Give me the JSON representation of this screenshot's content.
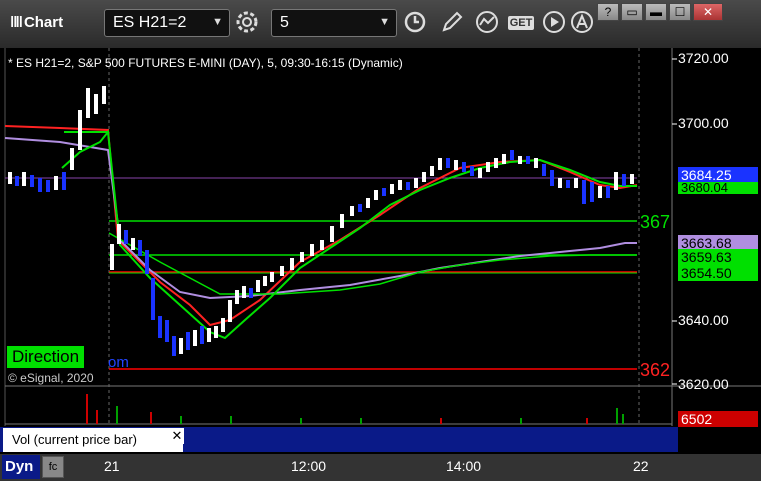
{
  "window": {
    "title": "Chart",
    "symbol": "ES H21=2",
    "interval": "5",
    "buttons": {
      "help": "?",
      "restore": "▭",
      "maximize": "☐",
      "close": "✕"
    }
  },
  "chart": {
    "header": "* ES H21=2, S&P 500 FUTURES E-MINI (DAY), 5, 09:30-16:15 (Dynamic)",
    "direction_label": "Direction",
    "copyright": "© eSignal, 2020",
    "fragment": "om",
    "y_ticks": [
      "3720.00",
      "3700.00",
      "3640.00",
      "3620.00"
    ],
    "x_ticks": [
      "21",
      "12:00",
      "14:00",
      "22"
    ],
    "price_labels": [
      {
        "text": "3684.25",
        "bg": "#1a33ff",
        "fg": "#ffffff"
      },
      {
        "text": "3680.04",
        "bg": "#00e000",
        "fg": "#000000"
      },
      {
        "text": "3663.68",
        "bg": "#b08ee0",
        "fg": "#000000"
      },
      {
        "text": "3659.63",
        "bg": "#00e000",
        "fg": "#000000"
      },
      {
        "text": "3654.50",
        "bg": "#00e000",
        "fg": "#000000"
      },
      {
        "text": "6502",
        "bg": "#cc0000",
        "fg": "#ffffff"
      }
    ],
    "line_labels": {
      "green_level": "367",
      "red_level": "362"
    }
  },
  "volume": {
    "label": "Vol (current price bar)",
    "close": "✕"
  },
  "bottom": {
    "mode": "Dyn",
    "fc": "fc"
  },
  "colors": {
    "up": "#ffffff",
    "down": "#1a33ff",
    "green": "#00e000",
    "red": "#ff0000",
    "purple": "#b08ee0"
  }
}
